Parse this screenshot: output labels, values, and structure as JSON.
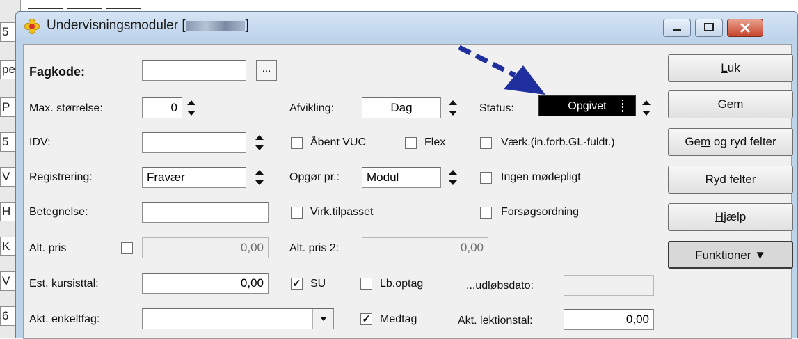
{
  "window": {
    "title": "Undervisningsmoduler [",
    "title_suffix": "]"
  },
  "bg_rows": [
    "5",
    "pe",
    "P",
    "5",
    "V",
    "H",
    "K",
    "V",
    "6"
  ],
  "fields": {
    "fagkode": {
      "label": "Fagkode:",
      "value": "",
      "dots": "..."
    },
    "max_size": {
      "label": "Max. størrelse:",
      "value": "0"
    },
    "afvikling": {
      "label": "Afvikling:",
      "value": "Dag"
    },
    "status": {
      "label": "Status:",
      "value": "Opgivet"
    },
    "idv": {
      "label": "IDV:",
      "value": ""
    },
    "registrering": {
      "label": "Registrering:",
      "value": "Fravær"
    },
    "opgor": {
      "label": "Opgør pr.:",
      "value": "Modul"
    },
    "betegnelse": {
      "label": "Betegnelse:",
      "value": ""
    },
    "alt_pris": {
      "label": "Alt. pris",
      "value": "0,00"
    },
    "alt_pris2": {
      "label": "Alt. pris 2:",
      "value": "0,00"
    },
    "est_kursisttal": {
      "label": "Est. kursisttal:",
      "value": "0,00"
    },
    "udlobsdato": {
      "label": "...udløbsdato:",
      "value": ""
    },
    "akt_enkeltfag": {
      "label": "Akt. enkeltfag:",
      "value": ""
    },
    "akt_lektionstal": {
      "label": "Akt. lektionstal:",
      "value": "0,00"
    }
  },
  "checkboxes": {
    "abent_vuc": {
      "label": "Åbent VUC",
      "checked": false
    },
    "flex": {
      "label": "Flex",
      "checked": false
    },
    "vaerk": {
      "label": "Værk.(in.forb.GL-fuldt.)",
      "checked": false
    },
    "ingen_modepligt": {
      "label": "Ingen mødepligt",
      "checked": false
    },
    "virk_tilpasset": {
      "label": "Virk.tilpasset",
      "checked": false
    },
    "forsogsordning": {
      "label": "Forsøgsordning",
      "checked": false
    },
    "alt_pris": {
      "label": "",
      "checked": false
    },
    "su": {
      "label": "SU",
      "checked": true,
      "mark": "✓"
    },
    "lb_optag": {
      "label": "Lb.optag",
      "checked": false
    },
    "medtag": {
      "label": "Medtag",
      "checked": true,
      "mark": "✓"
    }
  },
  "buttons": {
    "luk": {
      "pre": "",
      "key": "L",
      "post": "uk"
    },
    "gem": {
      "pre": "",
      "key": "G",
      "post": "em"
    },
    "gem_ryd": {
      "pre": "Ge",
      "key": "m",
      "post": " og ryd felter"
    },
    "ryd": {
      "pre": "",
      "key": "R",
      "post": "yd felter"
    },
    "hjaelp": {
      "pre": "",
      "key": "H",
      "post": "jælp"
    },
    "funktioner": {
      "pre": "Fun",
      "key": "k",
      "post": "tioner ▼"
    }
  },
  "colors": {
    "arrow": "#1f2f9e",
    "title_bg": "#bcd3ea",
    "status_bg": "#000000"
  }
}
